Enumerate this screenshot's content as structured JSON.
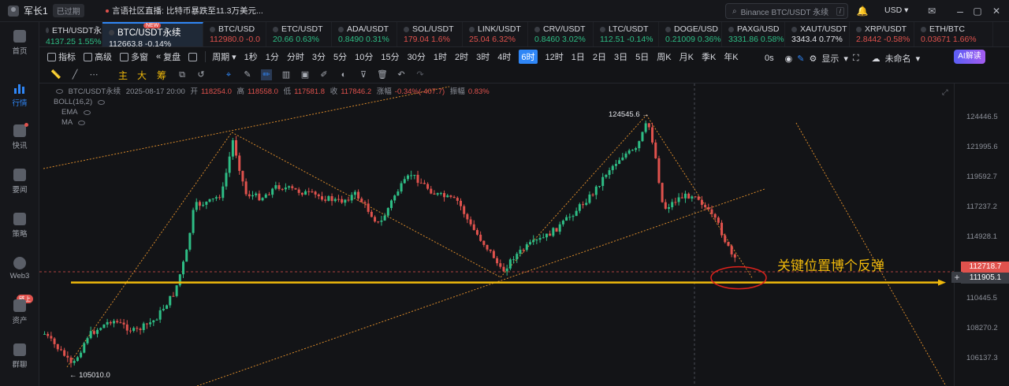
{
  "topbar": {
    "user_name": "军长1",
    "expired_label": "已过期",
    "broadcast": "言语社区直播: 比特币暴跌至11.3万美元...",
    "search_placeholder": "Binance BTC/USDT 永续",
    "search_shortcut": "/",
    "currency": "USD"
  },
  "sidebar": {
    "items": [
      {
        "label": "首页",
        "icon": "home-icon"
      },
      {
        "label": "行情",
        "icon": "chart-bars-icon"
      },
      {
        "label": "快讯",
        "icon": "news-icon"
      },
      {
        "label": "要闻",
        "icon": "document-icon"
      },
      {
        "label": "策略",
        "icon": "robot-icon"
      },
      {
        "label": "Web3",
        "icon": "web3-icon"
      },
      {
        "label": "资产",
        "icon": "wallet-icon",
        "badge": "链上"
      },
      {
        "label": "群聊",
        "icon": "chat-icon"
      }
    ]
  },
  "tickers": [
    {
      "symbol": "ETH/USDT永",
      "value": "4137.25 1.55%",
      "dir": "up"
    },
    {
      "symbol": "BTC/USDT永续",
      "value": "112663.8 -0.14%",
      "dir": "neutral",
      "active": true,
      "tag": "NEW"
    },
    {
      "symbol": "BTC/USD",
      "value": "112980.0 -0.0",
      "dir": "down"
    },
    {
      "symbol": "ETC/USDT",
      "value": "20.66 0.63%",
      "dir": "up"
    },
    {
      "symbol": "ADA/USDT",
      "value": "0.8490 0.31%",
      "dir": "up"
    },
    {
      "symbol": "SOL/USDT",
      "value": "179.04 1.6%",
      "dir": "down"
    },
    {
      "symbol": "LINK/USDT",
      "value": "25.04 6.32%",
      "dir": "down"
    },
    {
      "symbol": "CRV/USDT",
      "value": "0.8460 3.02%",
      "dir": "up"
    },
    {
      "symbol": "LTC/USDT",
      "value": "112.51 -0.14%",
      "dir": "up"
    },
    {
      "symbol": "DOGE/USD",
      "value": "0.21009 0.36%",
      "dir": "up"
    },
    {
      "symbol": "PAXG/USD",
      "value": "3331.86 0.58%",
      "dir": "up"
    },
    {
      "symbol": "XAUT/USDT",
      "value": "3343.4 0.77%",
      "dir": "neutral"
    },
    {
      "symbol": "XRP/USDT",
      "value": "2.8442 -0.58%",
      "dir": "down"
    },
    {
      "symbol": "ETH/BTC",
      "value": "0.03671 1.66%",
      "dir": "down"
    }
  ],
  "toolbar": {
    "indicators": "指标",
    "advanced": "高级",
    "multi_window": "多窗",
    "replay": "复盘",
    "period": "周期",
    "periods": [
      "1秒",
      "1分",
      "分时",
      "3分",
      "5分",
      "10分",
      "15分",
      "30分",
      "1时",
      "2时",
      "3时",
      "4时",
      "6时",
      "12时",
      "1日",
      "2日",
      "3日",
      "5日",
      "周K",
      "月K",
      "季K",
      "年K"
    ],
    "active_period": "6时",
    "countdown": "0s",
    "display": "显示",
    "unnamed": "未命名",
    "ai_read": "AI解读",
    "draw_labels": [
      "主",
      "大",
      "筹"
    ]
  },
  "legend": {
    "symbol": "BTC/USDT永续",
    "datetime": "2025-08-17 20:00",
    "open_label": "开",
    "open": "118254.0",
    "high_label": "高",
    "high": "118558.0",
    "low_label": "低",
    "low": "117581.8",
    "close_label": "收",
    "close": "117846.2",
    "change_label": "涨幅",
    "change": "-0.34%(-407.7)",
    "amplitude_label": "振幅",
    "amplitude": "0.83%",
    "indicators": [
      "BOLL(16,2)",
      "EMA",
      "MA"
    ]
  },
  "chart_data": {
    "type": "candlestick",
    "y_ticks": [
      "124446.5",
      "121995.6",
      "119592.7",
      "117237.2",
      "114928.1",
      "112718.7",
      "111905.1",
      "110445.5",
      "108270.2",
      "106137.3"
    ],
    "current_price": "112718.7",
    "line_price": "111905.1",
    "high_marker": "124545.6",
    "low_marker": "105010.0",
    "annotation": "关键位置博个反弹",
    "colors": {
      "up": "#2ebd85",
      "down": "#e0524d",
      "line": "#f0b90b",
      "trend": "#d98a2b"
    }
  }
}
